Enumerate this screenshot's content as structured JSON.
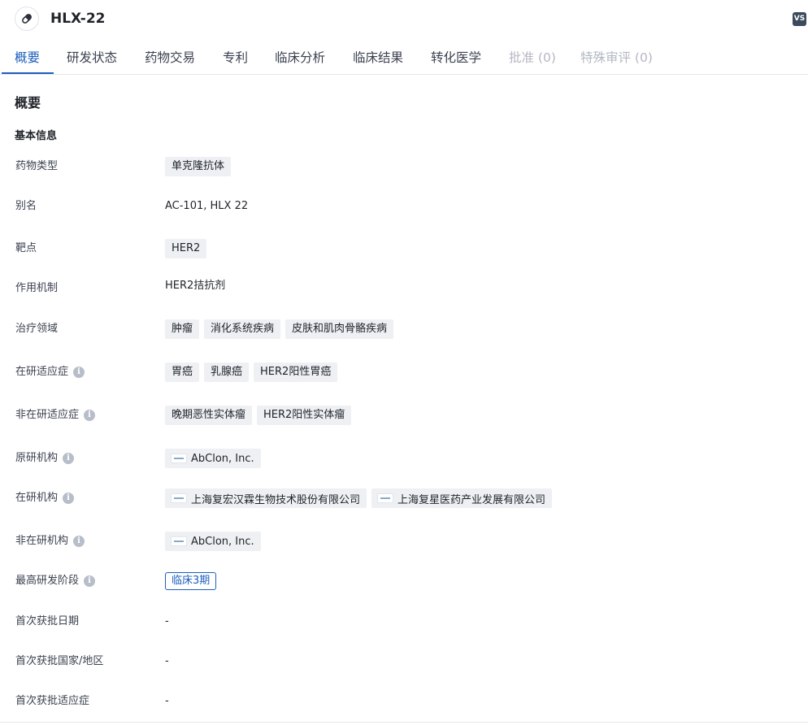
{
  "header": {
    "drug_name": "HLX-22",
    "badge": "VS",
    "avatar_icon": "pill-icon"
  },
  "tabs": [
    {
      "label": "概要",
      "state": "active"
    },
    {
      "label": "研发状态",
      "state": "normal"
    },
    {
      "label": "药物交易",
      "state": "normal"
    },
    {
      "label": "专利",
      "state": "normal"
    },
    {
      "label": "临床分析",
      "state": "normal"
    },
    {
      "label": "临床结果",
      "state": "normal"
    },
    {
      "label": "转化医学",
      "state": "normal"
    },
    {
      "label": "批准 (0)",
      "state": "disabled"
    },
    {
      "label": "特殊审评 (0)",
      "state": "disabled"
    }
  ],
  "section_title": "概要",
  "subsection_title": "基本信息",
  "fields": {
    "drug_type": {
      "label": "药物类型",
      "tags": [
        "单克隆抗体"
      ]
    },
    "aliases": {
      "label": "别名",
      "value": "AC-101,  HLX 22"
    },
    "target": {
      "label": "靶点",
      "tags": [
        "HER2"
      ]
    },
    "mechanism": {
      "label": "作用机制",
      "value": "HER2拮抗剂"
    },
    "therapeutic_areas": {
      "label": "治疗领域",
      "tags": [
        "肿瘤",
        "消化系统疾病",
        "皮肤和肌肉骨骼疾病"
      ]
    },
    "active_indications": {
      "label": "在研适应症",
      "tags": [
        "胃癌",
        "乳腺癌",
        "HER2阳性胃癌"
      ]
    },
    "inactive_indications": {
      "label": "非在研适应症",
      "tags": [
        "晚期恶性实体瘤",
        "HER2阳性实体瘤"
      ]
    },
    "originator": {
      "label": "原研机构",
      "orgs": [
        "AbClon, Inc."
      ]
    },
    "active_orgs": {
      "label": "在研机构",
      "orgs": [
        "上海复宏汉霖生物技术股份有限公司",
        "上海复星医药产业发展有限公司"
      ]
    },
    "inactive_orgs": {
      "label": "非在研机构",
      "orgs": [
        "AbClon, Inc."
      ]
    },
    "highest_phase": {
      "label": "最高研发阶段",
      "value": "临床3期"
    },
    "first_approval_date": {
      "label": "首次获批日期",
      "value": "-"
    },
    "first_approval_country": {
      "label": "首次获批国家/地区",
      "value": "-"
    },
    "first_approval_indication": {
      "label": "首次获批适应症",
      "value": "-"
    }
  },
  "colors": {
    "accent": "#1c5fbd",
    "tag_bg": "#eef0f3",
    "disabled_text": "#b3b8c2",
    "badge_bg": "#3b4a5c"
  }
}
